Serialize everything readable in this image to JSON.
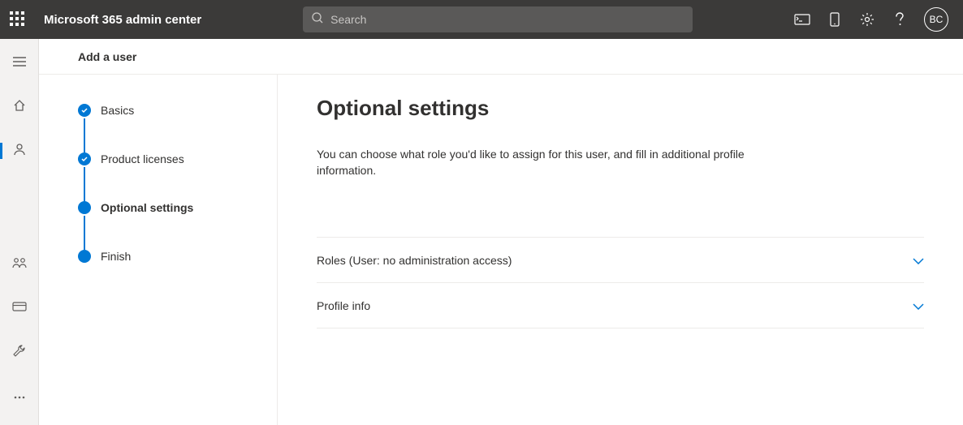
{
  "header": {
    "app_title": "Microsoft 365 admin center",
    "search_placeholder": "Search",
    "avatar_initials": "BC"
  },
  "content": {
    "page_title": "Add a user"
  },
  "wizard": {
    "steps": [
      {
        "label": "Basics",
        "state": "done"
      },
      {
        "label": "Product licenses",
        "state": "done"
      },
      {
        "label": "Optional settings",
        "state": "current"
      },
      {
        "label": "Finish",
        "state": "pending"
      }
    ]
  },
  "panel": {
    "title": "Optional settings",
    "description": "You can choose what role you'd like to assign for this user, and fill in additional profile information.",
    "sections": [
      {
        "label": "Roles (User: no administration access)"
      },
      {
        "label": "Profile info"
      }
    ]
  }
}
